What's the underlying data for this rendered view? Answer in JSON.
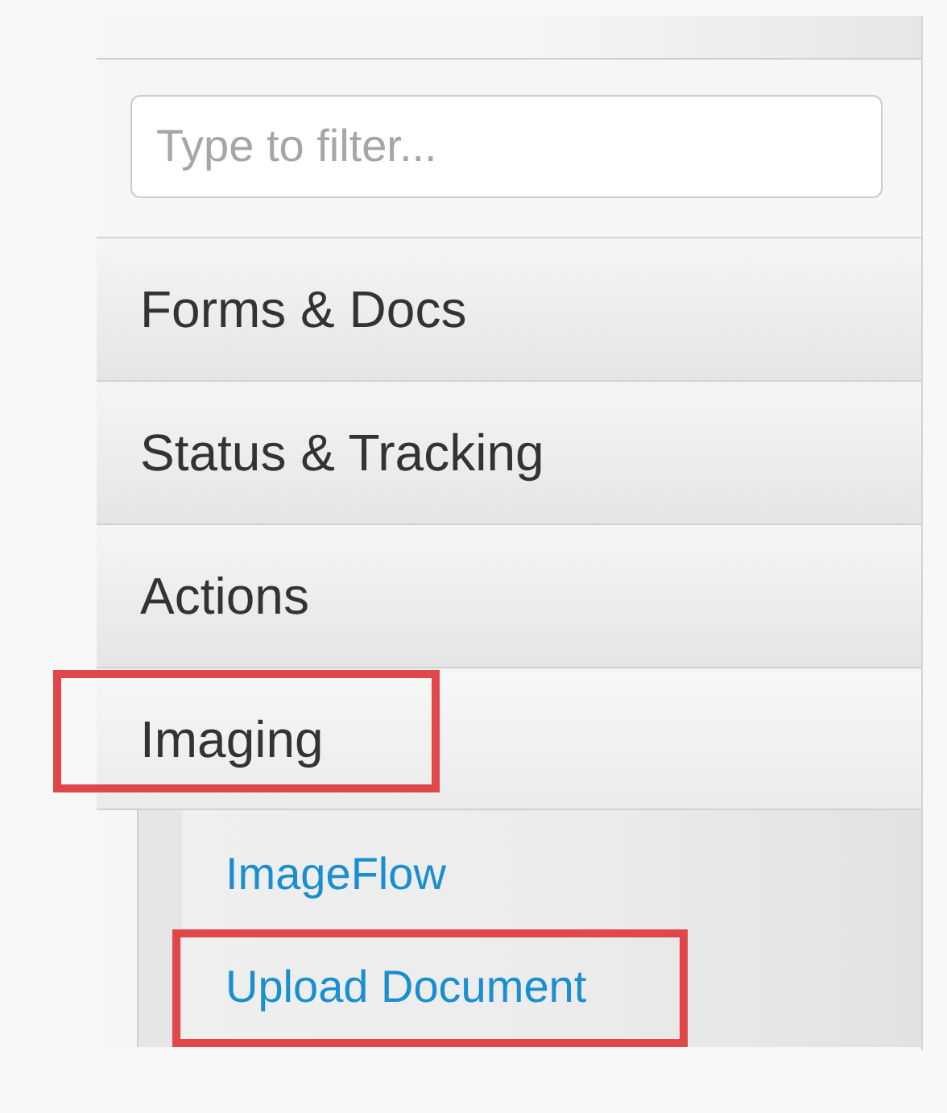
{
  "filter": {
    "placeholder": "Type to filter..."
  },
  "menu": [
    {
      "label": "Forms & Docs",
      "expanded": false,
      "highlighted": false
    },
    {
      "label": "Status & Tracking",
      "expanded": false,
      "highlighted": false
    },
    {
      "label": "Actions",
      "expanded": false,
      "highlighted": false
    },
    {
      "label": "Imaging",
      "expanded": true,
      "highlighted": true,
      "children": [
        {
          "label": "ImageFlow",
          "highlighted": false
        },
        {
          "label": "Upload Document",
          "highlighted": true
        }
      ]
    }
  ]
}
